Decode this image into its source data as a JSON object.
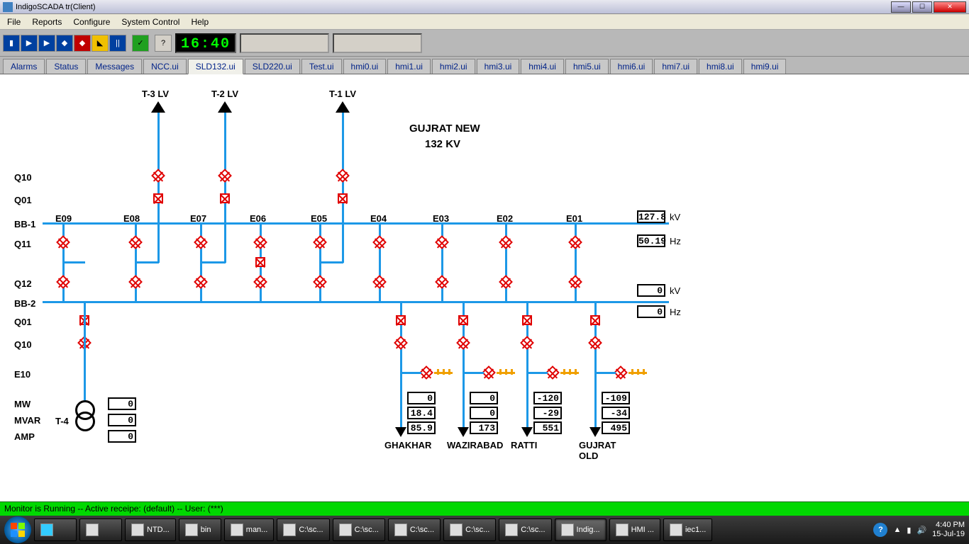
{
  "window": {
    "title": "IndigoSCADA tr(Client)"
  },
  "menu": [
    "File",
    "Reports",
    "Configure",
    "System Control",
    "Help"
  ],
  "clock": "16:40",
  "tabs": [
    "Alarms",
    "Status",
    "Messages",
    "NCC.ui",
    "SLD132.ui",
    "SLD220.ui",
    "Test.ui",
    "hmi0.ui",
    "hmi1.ui",
    "hmi2.ui",
    "hmi3.ui",
    "hmi4.ui",
    "hmi5.ui",
    "hmi6.ui",
    "hmi7.ui",
    "hmi8.ui",
    "hmi9.ui"
  ],
  "active_tab": "SLD132.ui",
  "sld": {
    "title1": "GUJRAT NEW",
    "title2": "132 KV",
    "t3": "T-3 LV",
    "t2": "T-2 LV",
    "t1": "T-1 LV",
    "q10": "Q10",
    "q01": "Q01",
    "bb1": "BB-1",
    "q11": "Q11",
    "q12": "Q12",
    "bb2": "BB-2",
    "q01b": "Q01",
    "q10b": "Q10",
    "e10": "E10",
    "e09": "E09",
    "e08": "E08",
    "e07": "E07",
    "e06": "E06",
    "e05": "E05",
    "e04": "E04",
    "e03": "E03",
    "e02": "E02",
    "e01": "E01",
    "mw": "MW",
    "mvar": "MVAR",
    "amp": "AMP",
    "t4": "T-4",
    "kv_lbl": "kV",
    "hz_lbl": "Hz",
    "bb1_kv": "127.8",
    "bb1_hz": "50.19",
    "bb2_kv": "0",
    "bb2_hz": "0",
    "t4_mw": "0",
    "t4_mvar": "0",
    "t4_amp": "0",
    "feeders": {
      "ghakhar": {
        "name": "GHAKHAR",
        "mw": "0",
        "mvar": "18.4",
        "amp": "85.9"
      },
      "wazirabad": {
        "name": "WAZIRABAD",
        "mw": "0",
        "mvar": "0",
        "amp": "173"
      },
      "ratti": {
        "name": "RATTI",
        "mw": "-120",
        "mvar": "-29",
        "amp": "551"
      },
      "gujratold": {
        "name": "GUJRAT OLD",
        "mw": "-109",
        "mvar": "-34",
        "amp": "495"
      }
    }
  },
  "status": "Monitor is Running -- Active receipe: (default) -- User: (***)",
  "taskbar": {
    "items": [
      "NTD...",
      "bin",
      "man...",
      "C:\\sc...",
      "C:\\sc...",
      "C:\\sc...",
      "C:\\sc...",
      "C:\\sc...",
      "Indig...",
      "HMI ...",
      "iec1..."
    ],
    "time": "4:40 PM",
    "date": "15-Jul-19"
  }
}
